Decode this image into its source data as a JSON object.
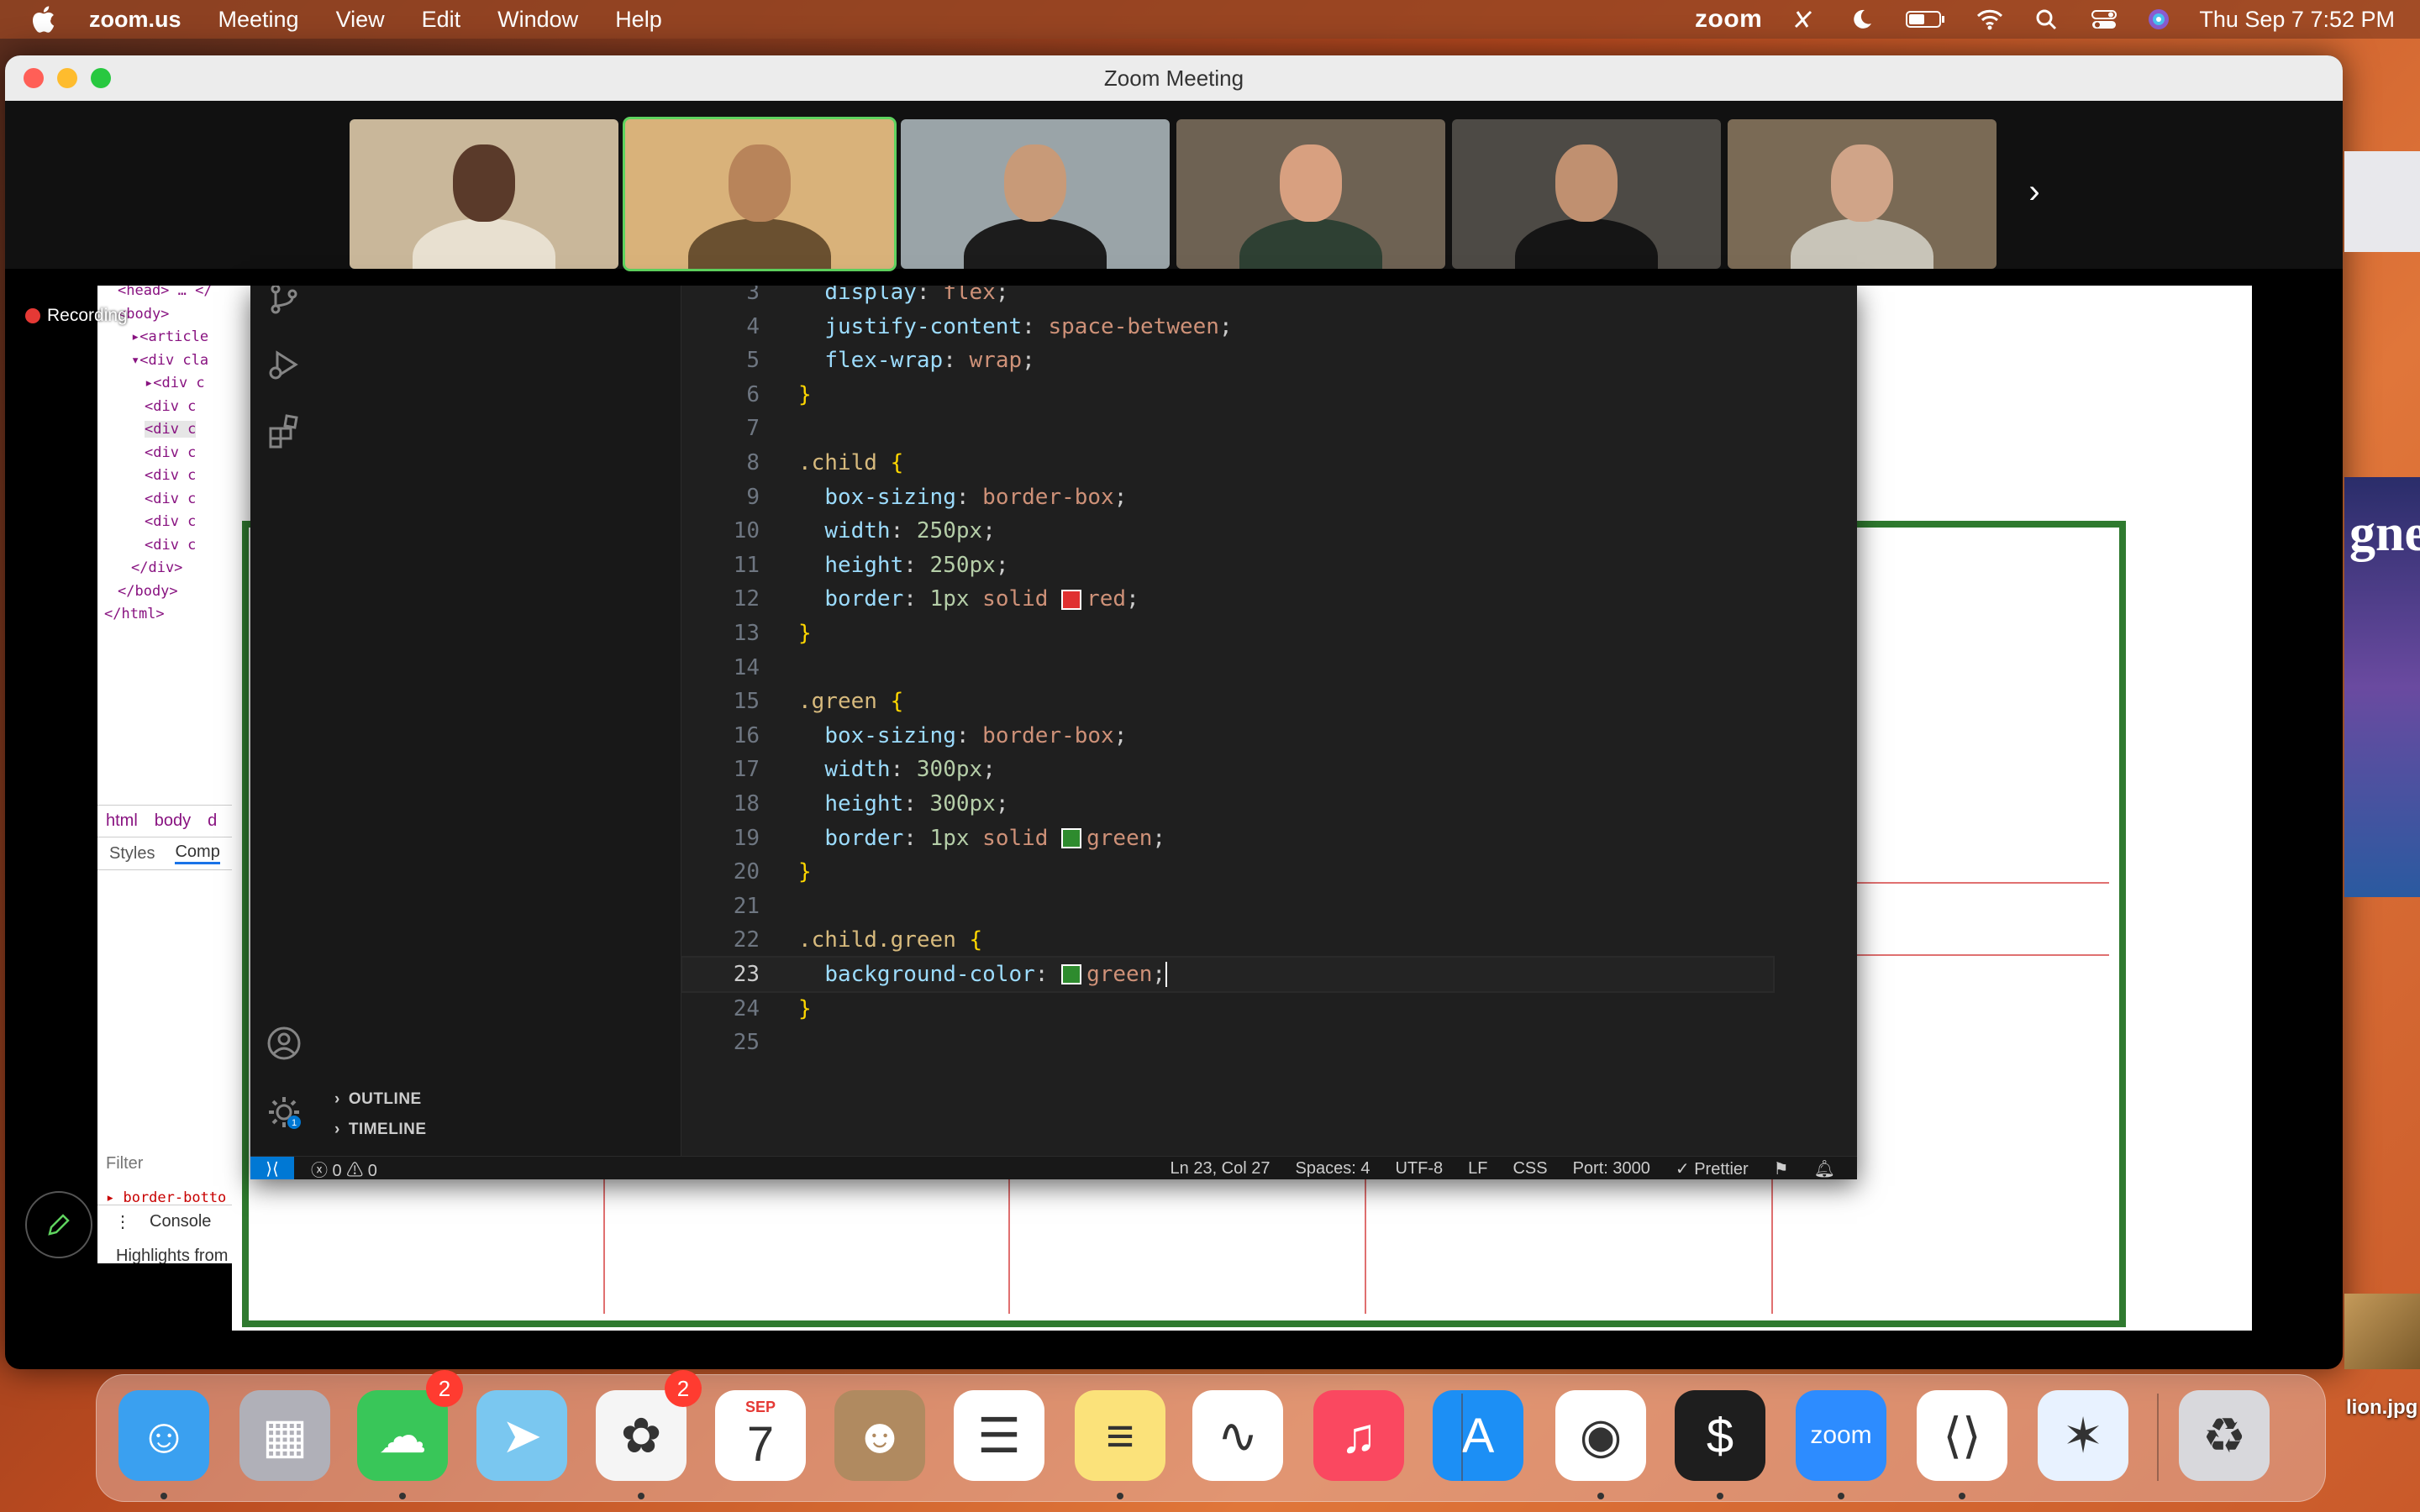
{
  "menubar": {
    "app_name": "zoom.us",
    "menus": [
      "Meeting",
      "View",
      "Edit",
      "Window",
      "Help"
    ],
    "status_app": "zoom",
    "clock": "Thu Sep 7  7:52 PM"
  },
  "zoom": {
    "window_title": "Zoom Meeting",
    "recording_label": "Recording",
    "participants": [
      {
        "tile_color": "#c9b79a",
        "skin": "#5a3a2a",
        "shirt": "#e8e0d0"
      },
      {
        "tile_color": "#d9b27a",
        "skin": "#b8845a",
        "shirt": "#6a5030"
      },
      {
        "tile_color": "#9aa4a8",
        "skin": "#c89a78",
        "shirt": "#1c1c1c"
      },
      {
        "tile_color": "#6e6253",
        "skin": "#d8a080",
        "shirt": "#2e4033"
      },
      {
        "tile_color": "#4d4a45",
        "skin": "#c09070",
        "shirt": "#151515"
      },
      {
        "tile_color": "#7a6a55",
        "skin": "#d0a488",
        "shirt": "#c8c4b8"
      }
    ]
  },
  "devtools": {
    "dom_lines": [
      {
        "text": "<head> … </",
        "indent": 0
      },
      {
        "text": "<body>",
        "indent": 0
      },
      {
        "text": "▸<article",
        "indent": 1
      },
      {
        "text": "▾<div cla",
        "indent": 1
      },
      {
        "text": "▸<div c",
        "indent": 2
      },
      {
        "text": "<div c",
        "indent": 2
      },
      {
        "text": "<div c",
        "indent": 2
      },
      {
        "text": "<div c",
        "indent": 2
      },
      {
        "text": "<div c",
        "indent": 2
      },
      {
        "text": "<div c",
        "indent": 2
      },
      {
        "text": "<div c",
        "indent": 2
      },
      {
        "text": "<div c",
        "indent": 2
      },
      {
        "text": "</div>",
        "indent": 1
      },
      {
        "text": "</body>",
        "indent": 0
      },
      {
        "text": "</html>",
        "indent": -1
      }
    ],
    "breadcrumbs": [
      "html",
      "body",
      "d"
    ],
    "tabs": [
      "Styles",
      "Comp"
    ],
    "filter_placeholder": "Filter",
    "style_line": "▸ border-botto",
    "console_label": "Console",
    "highlight_text": "Highlights from"
  },
  "vscode": {
    "code": [
      {
        "n": "3",
        "segs": [
          [
            "  ",
            ""
          ],
          [
            "display",
            "prop"
          ],
          [
            ": ",
            ""
          ],
          [
            "flex",
            "val"
          ],
          [
            ";",
            ""
          ]
        ]
      },
      {
        "n": "4",
        "segs": [
          [
            "  ",
            ""
          ],
          [
            "justify-content",
            "prop"
          ],
          [
            ": ",
            ""
          ],
          [
            "space-between",
            "val"
          ],
          [
            ";",
            ""
          ]
        ]
      },
      {
        "n": "5",
        "segs": [
          [
            "  ",
            ""
          ],
          [
            "flex-wrap",
            "prop"
          ],
          [
            ": ",
            ""
          ],
          [
            "wrap",
            "val"
          ],
          [
            ";",
            ""
          ]
        ]
      },
      {
        "n": "6",
        "segs": [
          [
            "}",
            "brace"
          ]
        ]
      },
      {
        "n": "7",
        "segs": []
      },
      {
        "n": "8",
        "segs": [
          [
            ".child",
            "sel"
          ],
          [
            " ",
            ""
          ],
          [
            "{",
            "brace"
          ]
        ]
      },
      {
        "n": "9",
        "segs": [
          [
            "  ",
            ""
          ],
          [
            "box-sizing",
            "prop"
          ],
          [
            ": ",
            ""
          ],
          [
            "border-box",
            "val"
          ],
          [
            ";",
            ""
          ]
        ]
      },
      {
        "n": "10",
        "segs": [
          [
            "  ",
            ""
          ],
          [
            "width",
            "prop"
          ],
          [
            ": ",
            ""
          ],
          [
            "250px",
            "num"
          ],
          [
            ";",
            ""
          ]
        ]
      },
      {
        "n": "11",
        "segs": [
          [
            "  ",
            ""
          ],
          [
            "height",
            "prop"
          ],
          [
            ": ",
            ""
          ],
          [
            "250px",
            "num"
          ],
          [
            ";",
            ""
          ]
        ]
      },
      {
        "n": "12",
        "segs": [
          [
            "  ",
            ""
          ],
          [
            "border",
            "prop"
          ],
          [
            ": ",
            ""
          ],
          [
            "1px",
            "num"
          ],
          [
            " ",
            ""
          ],
          [
            "solid",
            "val"
          ],
          [
            " ",
            ""
          ],
          [
            "#red",
            "swatch-red"
          ],
          [
            "red",
            "val"
          ],
          [
            ";",
            ""
          ]
        ]
      },
      {
        "n": "13",
        "segs": [
          [
            "}",
            "brace"
          ]
        ]
      },
      {
        "n": "14",
        "segs": []
      },
      {
        "n": "15",
        "segs": [
          [
            ".green",
            "sel"
          ],
          [
            " ",
            ""
          ],
          [
            "{",
            "brace"
          ]
        ]
      },
      {
        "n": "16",
        "segs": [
          [
            "  ",
            ""
          ],
          [
            "box-sizing",
            "prop"
          ],
          [
            ": ",
            ""
          ],
          [
            "border-box",
            "val"
          ],
          [
            ";",
            ""
          ]
        ]
      },
      {
        "n": "17",
        "segs": [
          [
            "  ",
            ""
          ],
          [
            "width",
            "prop"
          ],
          [
            ": ",
            ""
          ],
          [
            "300px",
            "num"
          ],
          [
            ";",
            ""
          ]
        ]
      },
      {
        "n": "18",
        "segs": [
          [
            "  ",
            ""
          ],
          [
            "height",
            "prop"
          ],
          [
            ": ",
            ""
          ],
          [
            "300px",
            "num"
          ],
          [
            ";",
            ""
          ]
        ]
      },
      {
        "n": "19",
        "segs": [
          [
            "  ",
            ""
          ],
          [
            "border",
            "prop"
          ],
          [
            ": ",
            ""
          ],
          [
            "1px",
            "num"
          ],
          [
            " ",
            ""
          ],
          [
            "solid",
            "val"
          ],
          [
            " ",
            ""
          ],
          [
            "#green",
            "swatch-green"
          ],
          [
            "green",
            "val"
          ],
          [
            ";",
            ""
          ]
        ]
      },
      {
        "n": "20",
        "segs": [
          [
            "}",
            "brace"
          ]
        ]
      },
      {
        "n": "21",
        "segs": []
      },
      {
        "n": "22",
        "segs": [
          [
            ".child",
            "sel"
          ],
          [
            ".green",
            "sel"
          ],
          [
            " ",
            ""
          ],
          [
            "{",
            "brace"
          ]
        ]
      },
      {
        "n": "23",
        "segs": [
          [
            "  ",
            ""
          ],
          [
            "background-color",
            "prop"
          ],
          [
            ": ",
            ""
          ],
          [
            "#green",
            "swatch-green"
          ],
          [
            "green",
            "val"
          ],
          [
            ";",
            ""
          ]
        ],
        "current": true
      },
      {
        "n": "24",
        "segs": [
          [
            "}",
            "brace"
          ]
        ]
      },
      {
        "n": "25",
        "segs": []
      }
    ],
    "sidebar_sections": [
      "OUTLINE",
      "TIMELINE"
    ],
    "settings_badge": "1",
    "status": {
      "problems": "ⓧ 0 ⚠ 0",
      "cursor": "Ln 23, Col 27",
      "spaces": "Spaces: 4",
      "encoding": "UTF-8",
      "eol": "LF",
      "language": "CSS",
      "port": "Port: 3000",
      "formatter": "✓ Prettier"
    }
  },
  "dock": {
    "apps": [
      {
        "name": "Finder",
        "color": "#3aa0f0",
        "glyph": "☺"
      },
      {
        "name": "Launchpad",
        "color": "#b0b0b8",
        "glyph": "▦"
      },
      {
        "name": "Messages",
        "color": "#39c659",
        "glyph": "☁",
        "badge": "2"
      },
      {
        "name": "Maps",
        "color": "#7ac7f0",
        "glyph": "➤"
      },
      {
        "name": "Photos",
        "color": "#f5f5f5",
        "glyph": "✿",
        "badge": "2"
      },
      {
        "name": "Calendar",
        "color": "#ffffff",
        "glyph": "7",
        "sub": "SEP"
      },
      {
        "name": "Contacts",
        "color": "#b08a60",
        "glyph": "☻"
      },
      {
        "name": "Reminders",
        "color": "#ffffff",
        "glyph": "☰"
      },
      {
        "name": "Notes",
        "color": "#fbe27a",
        "glyph": "≡"
      },
      {
        "name": "Freeform",
        "color": "#ffffff",
        "glyph": "∿"
      },
      {
        "name": "Music",
        "color": "#fa4860",
        "glyph": "♫"
      },
      {
        "name": "App Store",
        "color": "#1c8ff5",
        "glyph": "A"
      },
      {
        "name": "Chrome",
        "color": "#ffffff",
        "glyph": "◉"
      },
      {
        "name": "Terminal",
        "color": "#1e1e1e",
        "glyph": "$"
      },
      {
        "name": "Zoom",
        "color": "#2d8cff",
        "glyph": "zoom"
      },
      {
        "name": "VS Code",
        "color": "#ffffff",
        "glyph": "⟨⟩"
      },
      {
        "name": "Safari",
        "color": "#e8f2ff",
        "glyph": "✶"
      },
      {
        "name": "Trash",
        "color": "#d8d8dc",
        "glyph": "♻"
      }
    ],
    "desktop_file": "lion.jpg"
  }
}
